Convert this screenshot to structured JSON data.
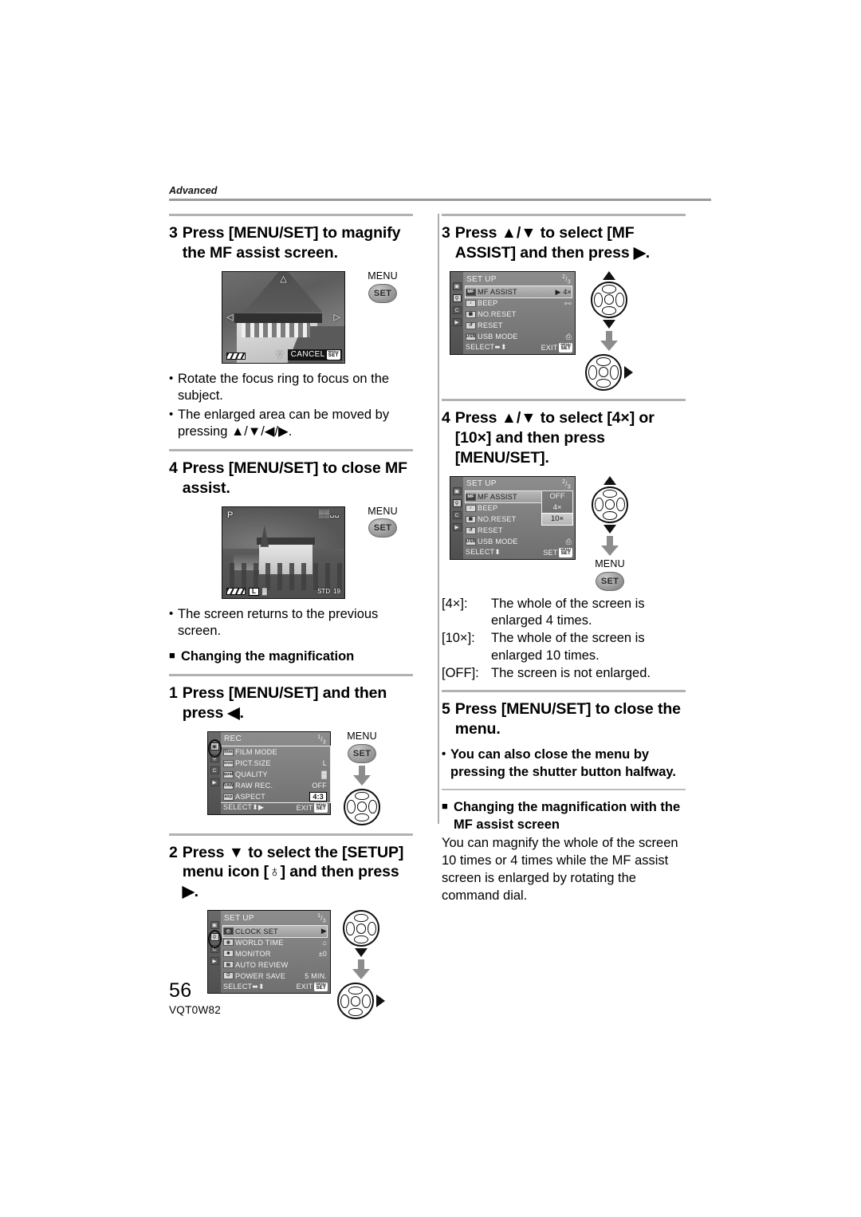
{
  "running_head": "Advanced",
  "footer": {
    "page_number": "56",
    "doc_code": "VQT0W82"
  },
  "left_column": {
    "step3": {
      "num": "3",
      "text": "Press [MENU/SET] to magnify the MF assist screen.",
      "lcd": {
        "up_arrow": "△",
        "down_arrow": "▽",
        "left_arrow": "◁",
        "right_arrow": "▷",
        "cancel_label": "CANCEL",
        "set_chip_top": "MENU",
        "set_chip_bottom": "SET"
      },
      "button": {
        "top_label": "MENU",
        "face_label": "SET"
      },
      "bullets": [
        "Rotate the focus ring to focus on the subject.",
        "The enlarged area can be moved by pressing ▲/▼/◀/▶."
      ]
    },
    "step4": {
      "num": "4",
      "text": "Press [MENU/SET] to close MF assist.",
      "lcd": {
        "mode": "P",
        "top_right": "▒▒␣␣",
        "battery": "battery-icon",
        "size_chip": "L",
        "quality": "▓",
        "std": "STD",
        "count": "19"
      },
      "button": {
        "top_label": "MENU",
        "face_label": "SET"
      },
      "bullets": [
        "The screen returns to the previous screen."
      ]
    },
    "sub_heading": "Changing the magnification",
    "step1": {
      "num": "1",
      "text": "Press [MENU/SET] and then press ◀.",
      "menu": {
        "title": "REC",
        "page_top": "1",
        "page_bottom": "3",
        "rows": [
          {
            "icon": "film",
            "name": "FILM MODE",
            "value": ""
          },
          {
            "icon": "size",
            "name": "PICT.SIZE",
            "value": "L"
          },
          {
            "icon": "qual",
            "name": "QUALITY",
            "value": "▓"
          },
          {
            "icon": "RAW",
            "name": "RAW REC.",
            "value": "OFF"
          },
          {
            "icon": "asp",
            "name": "ASPECT",
            "value": "4:3"
          }
        ],
        "footer_left": "SELECT",
        "footer_left_glyph": "⬍▶",
        "footer_right": "EXIT",
        "footer_chip_top": "MENU",
        "footer_chip_bottom": "SET",
        "tabs": [
          "rec",
          "setup",
          "custom",
          "play"
        ],
        "selected_tab": "rec"
      },
      "button": {
        "top_label": "MENU",
        "face_label": "SET"
      }
    },
    "step2": {
      "num": "2",
      "text": "Press ▼ to select the [SETUP] menu icon [♁] and then press ▶.",
      "menu": {
        "title": "SET UP",
        "page_top": "1",
        "page_bottom": "3",
        "rows": [
          {
            "icon": "clock",
            "name": "CLOCK SET",
            "value": "▶"
          },
          {
            "icon": "world",
            "name": "WORLD TIME",
            "value": "⌂"
          },
          {
            "icon": "mon",
            "name": "MONITOR",
            "value": "±0"
          },
          {
            "icon": "rev",
            "name": "AUTO REVIEW",
            "value": ""
          },
          {
            "icon": "pwr",
            "name": "POWER SAVE",
            "value": "5 MIN."
          }
        ],
        "footer_left": "SELECT",
        "footer_left_glyph": "⬌⬍",
        "footer_right": "EXIT",
        "footer_chip_top": "MENU",
        "footer_chip_bottom": "SET",
        "selected_tab": "setup"
      }
    }
  },
  "right_column": {
    "step3": {
      "num": "3",
      "text": "Press ▲/▼ to select [MF ASSIST] and then press ▶.",
      "menu": {
        "title": "SET UP",
        "page_top": "2",
        "page_bottom": "3",
        "rows": [
          {
            "icon": "MF",
            "name": "MF ASSIST",
            "value": "▶ 4×"
          },
          {
            "icon": "bp",
            "name": "BEEP",
            "value": "⧟"
          },
          {
            "icon": "NO",
            "name": "NO.RESET",
            "value": ""
          },
          {
            "icon": "R",
            "name": "RESET",
            "value": ""
          },
          {
            "icon": "USB",
            "name": "USB MODE",
            "value": "⎙"
          }
        ],
        "footer_left": "SELECT",
        "footer_left_glyph": "⬌⬍",
        "footer_right": "EXIT",
        "footer_chip_top": "MENU",
        "footer_chip_bottom": "SET",
        "highlight_row": 0,
        "selected_tab": "setup"
      }
    },
    "step4": {
      "num": "4",
      "text": "Press ▲/▼ to select [4×] or [10×] and then press [MENU/SET].",
      "menu": {
        "title": "SET UP",
        "page_top": "2",
        "page_bottom": "3",
        "rows": [
          {
            "icon": "MF",
            "name": "MF ASSIST",
            "value": ""
          },
          {
            "icon": "bp",
            "name": "BEEP",
            "value": ""
          },
          {
            "icon": "NO",
            "name": "NO.RESET",
            "value": ""
          },
          {
            "icon": "R",
            "name": "RESET",
            "value": ""
          },
          {
            "icon": "USB",
            "name": "USB MODE",
            "value": "⎙"
          }
        ],
        "dropdown_options": [
          {
            "label": "OFF",
            "selected": false
          },
          {
            "label": "4×",
            "selected": false
          },
          {
            "label": "10×",
            "selected": true
          }
        ],
        "footer_left": "SELECT",
        "footer_left_glyph": "⬍",
        "footer_right": "SET",
        "footer_chip_top": "MENU",
        "footer_chip_bottom": "SET",
        "selected_tab": "setup"
      },
      "button": {
        "top_label": "MENU",
        "face_label": "SET"
      }
    },
    "definitions": [
      {
        "key": "[4×]:",
        "value": "The whole of the screen is enlarged 4 times."
      },
      {
        "key": "[10×]:",
        "value": "The whole of the screen is enlarged 10 times."
      },
      {
        "key": "[OFF]:",
        "value": "The screen is not enlarged."
      }
    ],
    "step5": {
      "num": "5",
      "text": "Press [MENU/SET] to close the menu.",
      "bullets": [
        "You can also close the menu by pressing the shutter button halfway."
      ]
    },
    "sub_heading": "Changing the magnification with the MF assist screen",
    "body": "You can magnify the whole of the screen 10 times or 4 times while the MF assist screen is enlarged by rotating the command dial."
  }
}
